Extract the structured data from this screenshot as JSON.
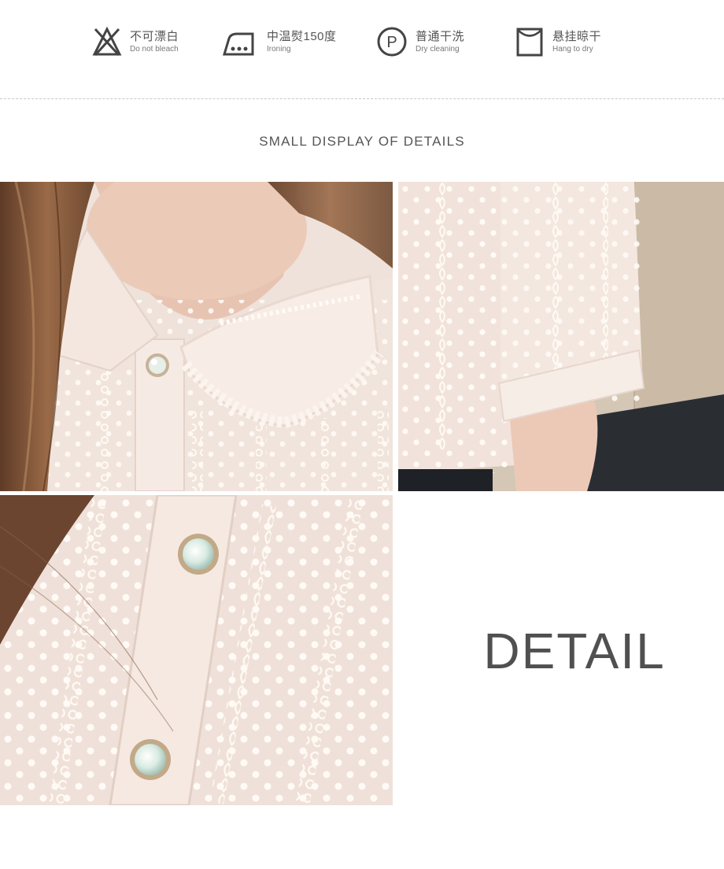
{
  "care": [
    {
      "icon": "no-bleach-icon",
      "cn": "不可漂白",
      "en": "Do not bleach"
    },
    {
      "icon": "iron-icon",
      "cn": "中温熨150度",
      "en": "Ironing"
    },
    {
      "icon": "dry-clean-icon",
      "cn": "普通干洗",
      "en": "Dry cleaning",
      "glyph": "P"
    },
    {
      "icon": "hang-dry-icon",
      "cn": "悬挂晾干",
      "en": "Hang to dry"
    }
  ],
  "section_title": "SMALL DISPLAY OF DETAILS",
  "detail_label": "DETAIL",
  "colors": {
    "fabric": "#f3e6df",
    "lace": "#fbf5ef",
    "hair": "#7a5238",
    "skin": "#e9c7b6",
    "text": "#505050"
  }
}
